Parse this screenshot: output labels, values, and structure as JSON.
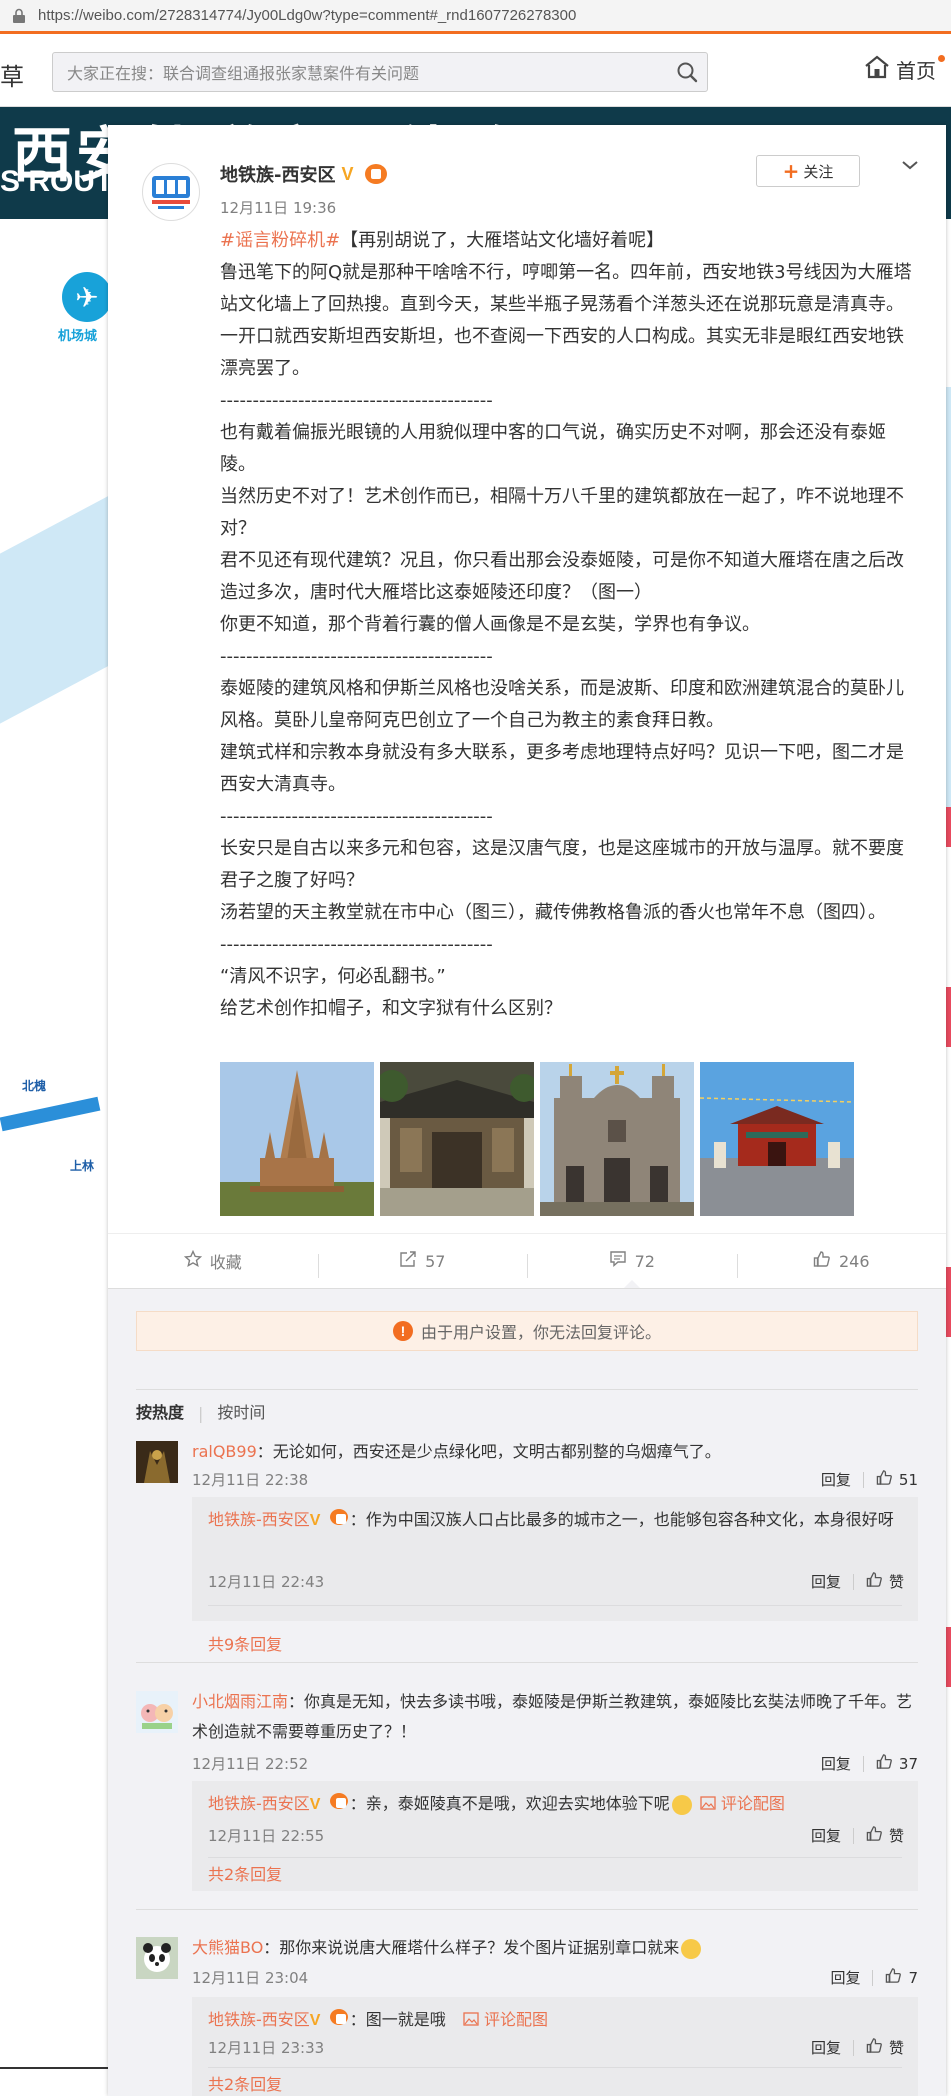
{
  "browser": {
    "url": "https://weibo.com/2728314774/Jy00Ldg0w?type=comment#_rnd1607726278300"
  },
  "nav": {
    "left_fragment": "草",
    "search_placeholder": "大家正在搜：联合调查组通报张家慧案件有关问题",
    "home_label": "首页"
  },
  "background": {
    "banner_title": "西安轨道交通线路图",
    "banner_sub": "S ROUT",
    "airport_label": "机场城",
    "station_labels": [
      "北槐",
      "上林"
    ]
  },
  "post": {
    "author": "地铁族-西安区",
    "time": "12月11日 19:36",
    "follow_label": "关注",
    "topic": "#谣言粉碎机#",
    "headline": "【再别胡说了，大雁塔站文化墙好着呢】",
    "paragraphs": [
      "鲁迅笔下的阿Q就是那种干啥啥不行，哼唧第一名。四年前，西安地铁3号线因为大雁塔站文化墙上了回热搜。直到今天，某些半瓶子晃荡看个洋葱头还在说那玩意是清真寺。一开口就西安斯坦西安斯坦，也不查阅一下西安的人口构成。其实无非是眼红西安地铁漂亮罢了。",
      "------------------------------------------",
      "也有戴着偏振光眼镜的人用貌似理中客的口气说，确实历史不对啊，那会还没有泰姬陵。",
      "当然历史不对了！艺术创作而已，相隔十万八千里的建筑都放在一起了，咋不说地理不对？",
      "君不见还有现代建筑？况且，你只看出那会没泰姬陵，可是你不知道大雁塔在唐之后改造过多次，唐时代大雁塔比这泰姬陵还印度？（图一）",
      "你更不知道，那个背着行囊的僧人画像是不是玄奘，学界也有争议。",
      "------------------------------------------",
      "泰姬陵的建筑风格和伊斯兰风格也没啥关系，而是波斯、印度和欧洲建筑混合的莫卧儿风格。莫卧儿皇帝阿克巴创立了一个自己为教主的素食拜日教。",
      "建筑式样和宗教本身就没有多大联系，更多考虑地理特点好吗？见识一下吧，图二才是西安大清真寺。",
      "------------------------------------------",
      "长安只是自古以来多元和包容，这是汉唐气度，也是这座城市的开放与温厚。就不要度君子之腹了好吗？",
      "汤若望的天主教堂就在市中心（图三），藏传佛教格鲁派的香火也常年不息（图四）。",
      "------------------------------------------",
      "“清风不识字，何必乱翻书。”",
      "给艺术创作扣帽子，和文字狱有什么区别？"
    ],
    "actions": {
      "favorite": "收藏",
      "repost": "57",
      "comment": "72",
      "like": "246"
    }
  },
  "comments_section": {
    "notice": "由于用户设置，你无法回复评论。",
    "sort_hot": "按热度",
    "sort_time": "按时间",
    "reply_label": "回复",
    "like_label": "赞",
    "image_link": "评论配图",
    "comments": [
      {
        "nick": "ralQB99",
        "text": "：无论如何，西安还是少点绿化吧，文明古都别整的乌烟瘴气了。",
        "time": "12月11日 22:38",
        "likes": "51",
        "reply": {
          "nick": "地铁族-西安区",
          "text": "：作为中国汉族人口占比最多的城市之一，也能够包容各种文化，本身很好呀",
          "time": "12月11日 22:43"
        },
        "more": "共9条回复"
      },
      {
        "nick": "小北烟雨江南",
        "text": "：你真是无知，快去多读书哦，泰姬陵是伊斯兰教建筑，泰姬陵比玄奘法师晚了千年。艺术创造就不需要尊重历史了？！",
        "time": "12月11日 22:52",
        "likes": "37",
        "reply": {
          "nick": "地铁族-西安区",
          "text": "：亲，泰姬陵真不是哦，欢迎去实地体验下呢",
          "time": "12月11日 22:55"
        },
        "more": "共2条回复"
      },
      {
        "nick": "大熊猫BO",
        "text": "：那你来说说唐大雁塔什么样子？发个图片证据别章口就来",
        "time": "12月11日 23:04",
        "likes": "7",
        "reply": {
          "nick": "地铁族-西安区",
          "text": "：图一就是哦",
          "time": "12月11日 23:33"
        },
        "more": "共2条回复"
      }
    ]
  }
}
